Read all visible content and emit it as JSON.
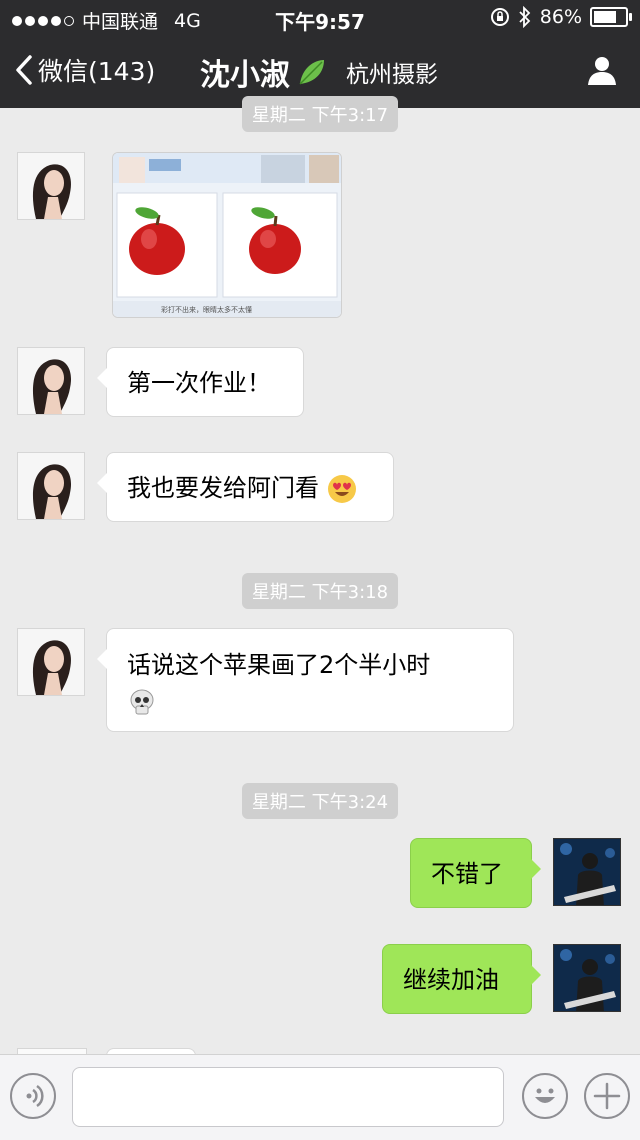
{
  "status": {
    "carrier": "中国联通",
    "network": "4G",
    "time": "下午9:57",
    "battery": "86%",
    "battery_level": 0.86
  },
  "nav": {
    "back_label": "微信(143)",
    "title": "沈小淑",
    "subtitle": "杭州摄影"
  },
  "timestamps": [
    "星期二 下午3:17",
    "星期二 下午3:18",
    "星期二 下午3:24"
  ],
  "messages": [
    {
      "side": "left",
      "type": "image",
      "caption": "彩打不出来，眼睛太多不太懂"
    },
    {
      "side": "left",
      "type": "text",
      "text": "第一次作业！"
    },
    {
      "side": "left",
      "type": "text",
      "text": "我也要发给阿门看",
      "emoji": "heart-eyes-emoji"
    },
    {
      "side": "left",
      "type": "text",
      "line1": "话说这个苹果画了2个半小时",
      "emoji": "skull-emoji"
    },
    {
      "side": "right",
      "type": "text",
      "text": "不错了"
    },
    {
      "side": "right",
      "type": "text",
      "text": "继续加油"
    }
  ],
  "colors": {
    "header_bg": "#2c2c2e",
    "chat_bg": "#ebebeb",
    "sent_bubble": "#9fe658",
    "received_bubble": "#ffffff",
    "timestamp_bg": "#cfcfcf"
  },
  "input_bar": {
    "icons": [
      "voice-icon",
      "emoji-icon",
      "plus-icon"
    ]
  }
}
